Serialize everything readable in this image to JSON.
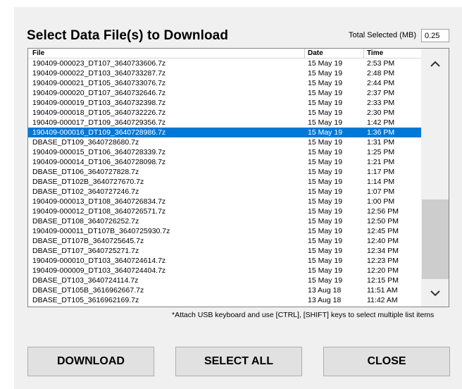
{
  "dialog": {
    "title": "Select Data File(s) to Download",
    "total_label": "Total Selected (MB)",
    "total_value": "0.25",
    "hint": "*Attach USB keyboard and use [CTRL], [SHIFT] keys to select multiple list items"
  },
  "list": {
    "headers": {
      "file": "File",
      "date": "Date",
      "time": "Time"
    },
    "selected_index": 7,
    "rows": [
      {
        "file": "190409-000023_DT107_3640733606.7z",
        "date": "15 May 19",
        "time": "2:53 PM"
      },
      {
        "file": "190409-000022_DT103_3640733287.7z",
        "date": "15 May 19",
        "time": "2:48 PM"
      },
      {
        "file": "190409-000021_DT105_3640733076.7z",
        "date": "15 May 19",
        "time": "2:44 PM"
      },
      {
        "file": "190409-000020_DT107_3640732646.7z",
        "date": "15 May 19",
        "time": "2:37 PM"
      },
      {
        "file": "190409-000019_DT103_3640732398.7z",
        "date": "15 May 19",
        "time": "2:33 PM"
      },
      {
        "file": "190409-000018_DT105_3640732226.7z",
        "date": "15 May 19",
        "time": "2:30 PM"
      },
      {
        "file": "190409-000017_DT109_3640729356.7z",
        "date": "15 May 19",
        "time": "1:42 PM"
      },
      {
        "file": "190409-000016_DT109_3640728986.7z",
        "date": "15 May 19",
        "time": "1:36 PM"
      },
      {
        "file": "DBASE_DT109_3640728680.7z",
        "date": "15 May 19",
        "time": "1:31 PM"
      },
      {
        "file": "190409-000015_DT106_3640728339.7z",
        "date": "15 May 19",
        "time": "1:25 PM"
      },
      {
        "file": "190409-000014_DT106_3640728098.7z",
        "date": "15 May 19",
        "time": "1:21 PM"
      },
      {
        "file": "DBASE_DT106_3640727828.7z",
        "date": "15 May 19",
        "time": "1:17 PM"
      },
      {
        "file": "DBASE_DT102B_3640727670.7z",
        "date": "15 May 19",
        "time": "1:14 PM"
      },
      {
        "file": "DBASE_DT102_3640727246.7z",
        "date": "15 May 19",
        "time": "1:07 PM"
      },
      {
        "file": "190409-000013_DT108_3640726834.7z",
        "date": "15 May 19",
        "time": "1:00 PM"
      },
      {
        "file": "190409-000012_DT108_3640726571.7z",
        "date": "15 May 19",
        "time": "12:56 PM"
      },
      {
        "file": "DBASE_DT108_3640726252.7z",
        "date": "15 May 19",
        "time": "12:50 PM"
      },
      {
        "file": "190409-000011_DT107B_3640725930.7z",
        "date": "15 May 19",
        "time": "12:45 PM"
      },
      {
        "file": "DBASE_DT107B_3640725645.7z",
        "date": "15 May 19",
        "time": "12:40 PM"
      },
      {
        "file": "DBASE_DT107_3640725271.7z",
        "date": "15 May 19",
        "time": "12:34 PM"
      },
      {
        "file": "190409-000010_DT103_3640724614.7z",
        "date": "15 May 19",
        "time": "12:23 PM"
      },
      {
        "file": "190409-000009_DT103_3640724404.7z",
        "date": "15 May 19",
        "time": "12:20 PM"
      },
      {
        "file": "DBASE_DT103_3640724114.7z",
        "date": "15 May 19",
        "time": "12:15 PM"
      },
      {
        "file": "DBASE_DT105B_3616962667.7z",
        "date": "13 Aug 18",
        "time": "11:51 AM"
      },
      {
        "file": "DBASE_DT105_3616962169.7z",
        "date": "13 Aug 18",
        "time": "11:42 AM"
      }
    ]
  },
  "scrollbar": {
    "up_icon": "chevron-up-icon",
    "down_icon": "chevron-down-icon"
  },
  "buttons": {
    "download": "DOWNLOAD",
    "select_all": "SELECT ALL",
    "close": "CLOSE"
  },
  "colors": {
    "selection": "#0078d7",
    "panel": "#f0f0f0",
    "button": "#e1e1e1"
  }
}
